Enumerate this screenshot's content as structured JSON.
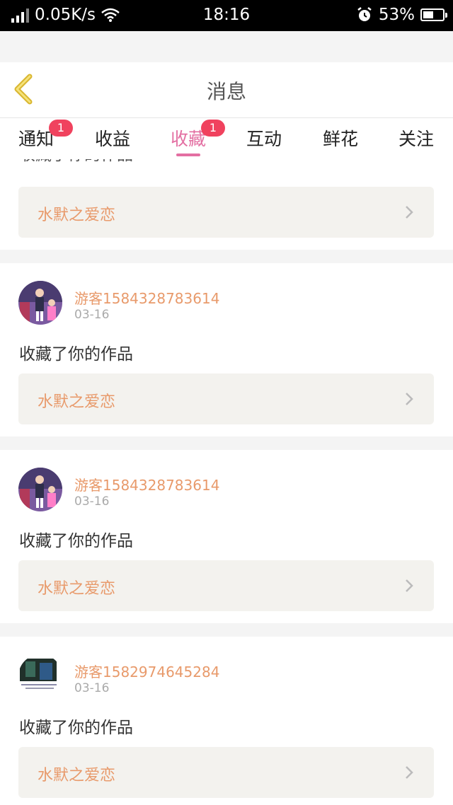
{
  "status_bar": {
    "network_speed": "0.05K/s",
    "time": "18:16",
    "battery": "53%",
    "battery_level": 0.53,
    "icons": [
      "signal-icon",
      "wifi-icon",
      "alarm-icon",
      "battery-icon"
    ]
  },
  "header": {
    "title": "消息",
    "back_icon": "chevron-left-icon"
  },
  "tabs": [
    {
      "label": "通知",
      "badge": "1"
    },
    {
      "label": "收益",
      "badge": ""
    },
    {
      "label": "收藏",
      "badge": "1",
      "active": true
    },
    {
      "label": "互动",
      "badge": ""
    },
    {
      "label": "鲜花",
      "badge": ""
    },
    {
      "label": "关注",
      "badge": ""
    }
  ],
  "messages": [
    {
      "author": "",
      "date": "",
      "action": "收藏了你的作品",
      "work_title": "水默之爱恋"
    },
    {
      "author": "游客1584328783614",
      "date": "03-16",
      "action": "收藏了你的作品",
      "work_title": "水默之爱恋"
    },
    {
      "author": "游客1584328783614",
      "date": "03-16",
      "action": "收藏了你的作品",
      "work_title": "水默之爱恋"
    },
    {
      "author": "游客1582974645284",
      "date": "03-16",
      "action": "收藏了你的作品",
      "work_title": "水默之爱恋"
    }
  ],
  "colors": {
    "accent": "#e36fa2",
    "badge": "#f0425e",
    "author": "#e89a6b",
    "link_bg": "#f3f2ee"
  }
}
